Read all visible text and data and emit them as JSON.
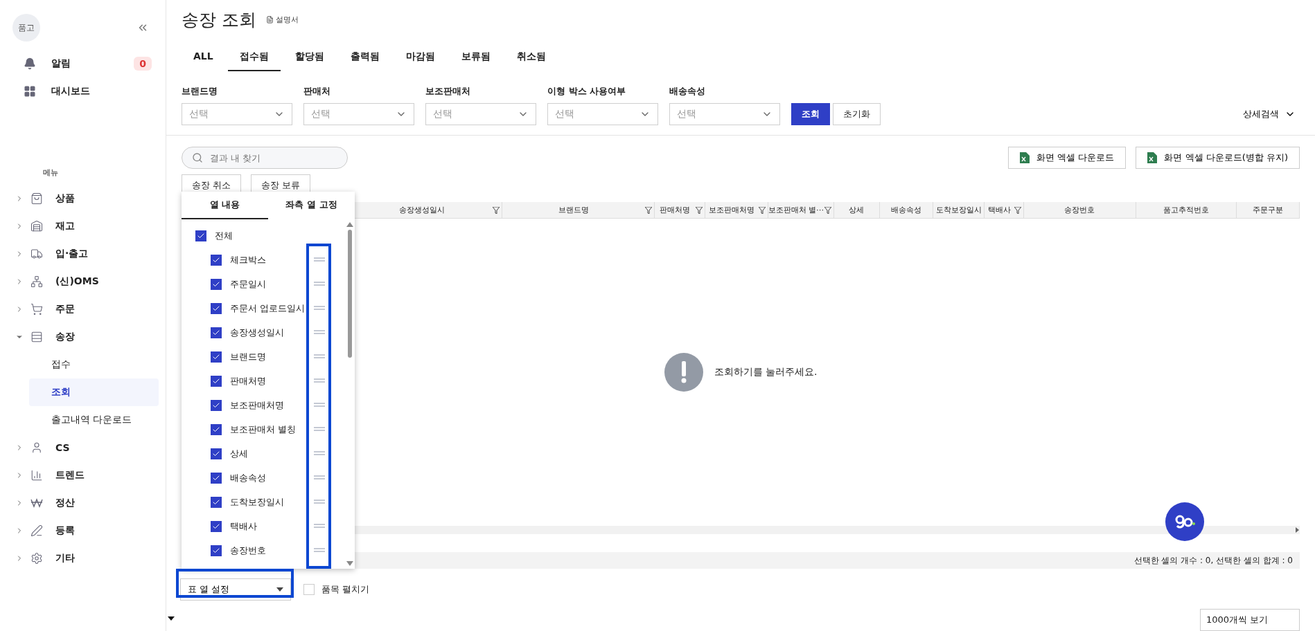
{
  "sidebar": {
    "logo_text": "품고",
    "alerts": {
      "label": "알림",
      "count": "0"
    },
    "dashboard": "대시보드",
    "menu_heading": "메뉴",
    "items": [
      {
        "label": "상품",
        "expanded": false
      },
      {
        "label": "재고",
        "expanded": false
      },
      {
        "label": "입·출고",
        "expanded": false
      },
      {
        "label": "(신)OMS",
        "expanded": false
      },
      {
        "label": "주문",
        "expanded": false
      },
      {
        "label": "송장",
        "expanded": true,
        "children": [
          {
            "label": "접수",
            "selected": false
          },
          {
            "label": "조회",
            "selected": true
          },
          {
            "label": "출고내역 다운로드",
            "selected": false
          }
        ]
      },
      {
        "label": "CS",
        "expanded": false
      },
      {
        "label": "트렌드",
        "expanded": false
      },
      {
        "label": "정산",
        "expanded": false
      },
      {
        "label": "등록",
        "expanded": false
      },
      {
        "label": "기타",
        "expanded": false
      }
    ]
  },
  "header": {
    "title": "송장 조회",
    "manual_link": "설명서"
  },
  "tabs": [
    {
      "label": "ALL",
      "selected": false
    },
    {
      "label": "접수됨",
      "selected": true
    },
    {
      "label": "할당됨",
      "selected": false
    },
    {
      "label": "출력됨",
      "selected": false
    },
    {
      "label": "마감됨",
      "selected": false
    },
    {
      "label": "보류됨",
      "selected": false
    },
    {
      "label": "취소됨",
      "selected": false
    }
  ],
  "filters": [
    {
      "label": "브랜드명",
      "placeholder": "선택"
    },
    {
      "label": "판매처",
      "placeholder": "선택"
    },
    {
      "label": "보조판매처",
      "placeholder": "선택"
    },
    {
      "label": "이형 박스 사용여부",
      "placeholder": "선택"
    },
    {
      "label": "배송속성",
      "placeholder": "선택"
    }
  ],
  "search_button": "조회",
  "reset_button": "초기화",
  "advanced_search": "상세검색",
  "result_search": {
    "placeholder": "결과 내 찾기"
  },
  "excel_buttons": [
    "화면 엑셀 다운로드",
    "화면 엑셀 다운로드(병합 유지)"
  ],
  "action_buttons": [
    "송장 취소",
    "송장 보류"
  ],
  "table": {
    "columns": [
      {
        "label": "송장생성일시",
        "filter": true
      },
      {
        "label": "브랜드명",
        "filter": true
      },
      {
        "label": "판매처명",
        "filter": true
      },
      {
        "label": "보조판매처명",
        "filter": true
      },
      {
        "label": "보조판매처 별⋯",
        "filter": true
      },
      {
        "label": "상세",
        "filter": false
      },
      {
        "label": "배송속성",
        "filter": false
      },
      {
        "label": "도착보장일시",
        "filter": false
      },
      {
        "label": "택배사",
        "filter": true
      },
      {
        "label": "송장번호",
        "filter": false
      },
      {
        "label": "품고추적번호",
        "filter": false
      },
      {
        "label": "주문구분",
        "filter": false
      }
    ],
    "empty_message": "조회하기를 눌러주세요.",
    "status_text": "선택한 셀의 개수 : 0, 선택한 셀의 합계 : 0"
  },
  "column_settings": {
    "tabs": [
      {
        "label": "열 내용",
        "selected": true
      },
      {
        "label": "좌측 열 고정",
        "selected": false
      }
    ],
    "all": {
      "label": "전체",
      "checked": true
    },
    "items": [
      {
        "label": "체크박스",
        "checked": true
      },
      {
        "label": "주문일시",
        "checked": true
      },
      {
        "label": "주문서 업로드일시",
        "checked": true
      },
      {
        "label": "송장생성일시",
        "checked": true
      },
      {
        "label": "브랜드명",
        "checked": true
      },
      {
        "label": "판매처명",
        "checked": true
      },
      {
        "label": "보조판매처명",
        "checked": true
      },
      {
        "label": "보조판매처 별칭",
        "checked": true
      },
      {
        "label": "상세",
        "checked": true
      },
      {
        "label": "배송속성",
        "checked": true
      },
      {
        "label": "도착보장일시",
        "checked": true
      },
      {
        "label": "택배사",
        "checked": true
      },
      {
        "label": "송장번호",
        "checked": true
      }
    ]
  },
  "settings_dropdown": "표 열 설정",
  "expand_items": {
    "label": "품목 펼치기",
    "checked": false
  },
  "page_size": "1000개씩 보기"
}
